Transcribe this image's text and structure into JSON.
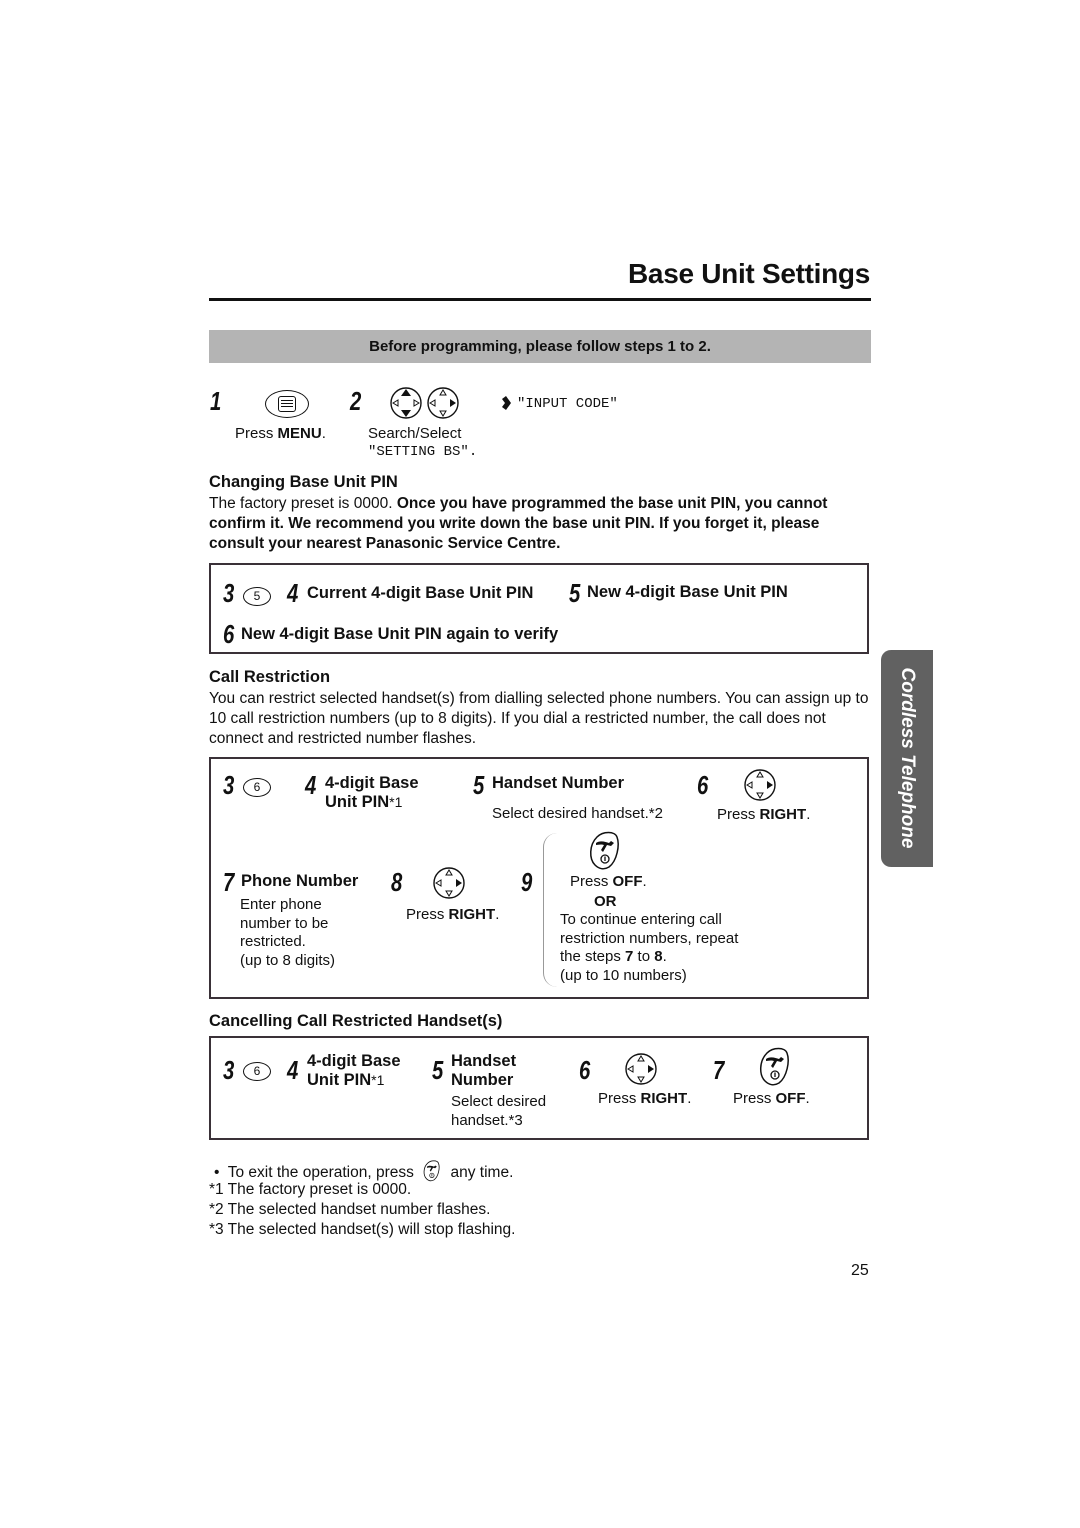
{
  "page": {
    "title": "Base Unit Settings",
    "banner": "Before programming, please follow steps 1 to 2.",
    "page_number": "25",
    "side_tab": "Cordless Telephone"
  },
  "prep": {
    "step1": {
      "num": "1",
      "icon": "menu-button-icon",
      "label_pre": "Press ",
      "label_bold": "MENU",
      "label_post": "."
    },
    "step2": {
      "num": "2",
      "icon": "navigator-key-icon",
      "label": "Search/Select",
      "display": "\"SETTING BS\".",
      "result": "\"INPUT CODE\""
    }
  },
  "changing_pin": {
    "heading": "Changing Base Unit PIN",
    "intro_plain": "The factory preset is 0000. ",
    "intro_bold": "Once you have programmed the base unit PIN, you cannot confirm it. We recommend you write down the base unit PIN. If you forget it, please consult your nearest Panasonic Service Centre.",
    "steps": [
      {
        "num": "3",
        "key": "5"
      },
      {
        "num": "4",
        "label": "Current 4-digit Base Unit PIN"
      },
      {
        "num": "5",
        "label": "New 4-digit Base Unit PIN"
      },
      {
        "num": "6",
        "label": "New 4-digit Base Unit PIN again to verify"
      }
    ]
  },
  "call_restriction": {
    "heading": "Call Restriction",
    "intro": "You can restrict selected handset(s) from dialling selected phone numbers. You can assign up to 10 call restriction numbers (up to 8 digits). If you dial a restricted number, the call does not connect and restricted number flashes.",
    "steps": {
      "s3": {
        "num": "3",
        "key": "6"
      },
      "s4": {
        "num": "4",
        "line1": "4-digit Base",
        "line2": "Unit PIN",
        "note": "*1"
      },
      "s5": {
        "num": "5",
        "label": "Handset Number",
        "desc": "Select desired handset.*2"
      },
      "s6": {
        "num": "6",
        "pre": "Press ",
        "bold": "RIGHT",
        "post": "."
      },
      "s7": {
        "num": "7",
        "label": "Phone Number",
        "desc": [
          "Enter phone",
          "number to be",
          "restricted.",
          "(up to 8 digits)"
        ]
      },
      "s8": {
        "num": "8",
        "pre": "Press ",
        "bold": "RIGHT",
        "post": "."
      },
      "s9": {
        "num": "9",
        "off_pre": "Press ",
        "off_bold": "OFF",
        "off_post": ".",
        "or": "OR",
        "alt_line1": "To continue entering call",
        "alt_line2": "restriction numbers, repeat",
        "alt_line3_pre": "the steps ",
        "alt_line3_b1": "7",
        "alt_line3_mid": " to ",
        "alt_line3_b2": "8",
        "alt_line3_post": ".",
        "alt_line4": "(up to 10 numbers)"
      }
    }
  },
  "cancelling": {
    "heading": "Cancelling Call Restricted Handset(s)",
    "steps": {
      "s3": {
        "num": "3",
        "key": "6"
      },
      "s4": {
        "num": "4",
        "line1": "4-digit Base",
        "line2": "Unit PIN",
        "note": "*1"
      },
      "s5": {
        "num": "5",
        "line1": "Handset",
        "line2": "Number",
        "desc1": "Select desired",
        "desc2": "handset.*3"
      },
      "s6": {
        "num": "6",
        "pre": "Press ",
        "bold": "RIGHT",
        "post": "."
      },
      "s7": {
        "num": "7",
        "pre": "Press ",
        "bold": "OFF",
        "post": "."
      }
    }
  },
  "notes": {
    "bullet_pre": "To exit the operation, press",
    "bullet_post": "any time.",
    "footnotes": [
      "*1 The factory preset is 0000.",
      "*2 The selected handset number flashes.",
      "*3 The selected handset(s) will stop flashing."
    ]
  }
}
